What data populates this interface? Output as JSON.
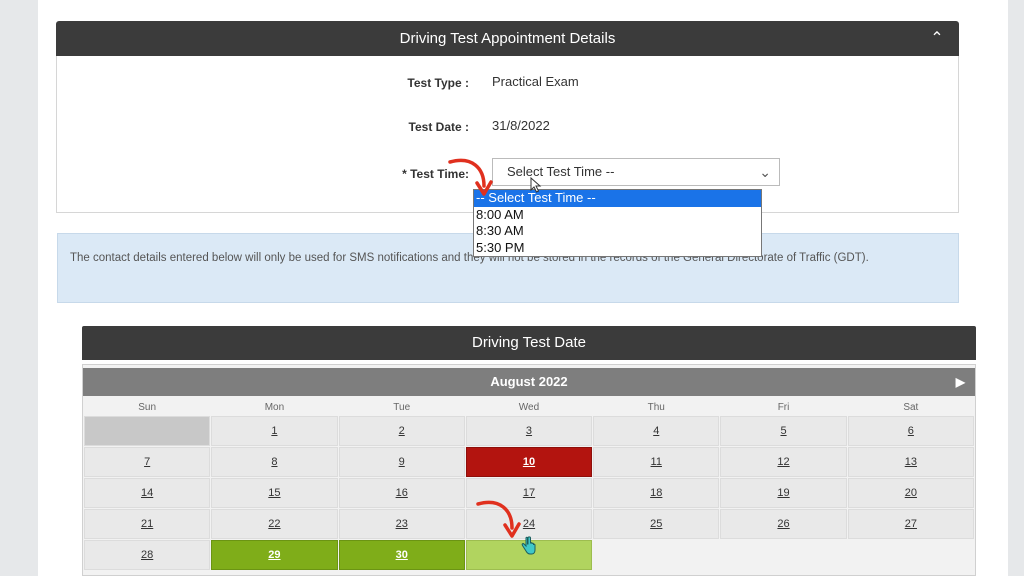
{
  "appointment": {
    "header_title": "Driving Test Appointment Details",
    "toggle_icon": "chevron-up-icon",
    "test_type_label": "Test Type :",
    "test_type_value": "Practical Exam",
    "test_date_label": "Test Date :",
    "test_date_value": "31/8/2022",
    "test_time_label": "* Test Time:",
    "test_time_selected": "Select Test Time --",
    "test_time_options": [
      "-- Select Test Time --",
      "8:00 AM",
      "8:30 AM",
      "5:30 PM"
    ]
  },
  "info": {
    "text": "The contact details entered below will only be used for SMS notifications and they will not be stored in the records of the General Directorate of Traffic (GDT)."
  },
  "calendar": {
    "header_title": "Driving Test Date",
    "month": "August 2022",
    "weekdays": [
      "Sun",
      "Mon",
      "Tue",
      "Wed",
      "Thu",
      "Fri",
      "Sat"
    ],
    "weeks": [
      [
        "",
        "1",
        "2",
        "3",
        "4",
        "5",
        "6"
      ],
      [
        "7",
        "8",
        "9",
        "10",
        "11",
        "12",
        "13"
      ],
      [
        "14",
        "15",
        "16",
        "17",
        "18",
        "19",
        "20"
      ],
      [
        "21",
        "22",
        "23",
        "24",
        "25",
        "26",
        "27"
      ],
      [
        "28",
        "29",
        "30",
        "31",
        "",
        "",
        ""
      ]
    ],
    "colors": {
      "unavailable": "#b3140f",
      "available": "#7fad19",
      "selected": "#b1d45f"
    },
    "highlight": {
      "red": [
        "10"
      ],
      "green": [
        "29",
        "30"
      ],
      "selected": [
        "31"
      ]
    }
  }
}
